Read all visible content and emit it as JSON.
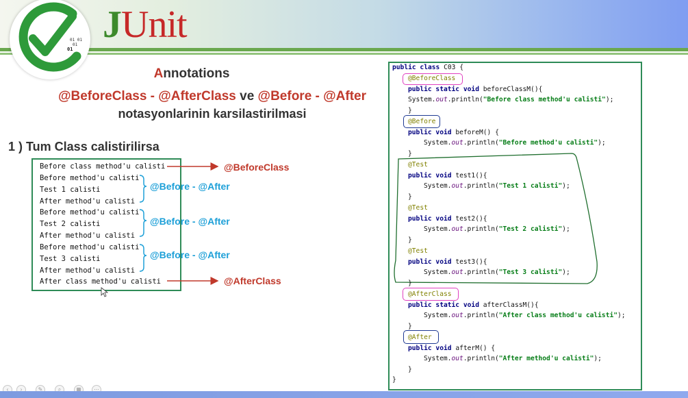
{
  "header": {
    "logo_text": "JUnit",
    "logo_j": "J",
    "logo_rest": "Unit",
    "logo_bits": "01 01 01"
  },
  "title": {
    "first": "A",
    "rest": "nnotations"
  },
  "subtitle": {
    "part1": "@BeforeClass - @AfterClass",
    "part2": " ve ",
    "part3": "@Before - @After",
    "line2": "notasyonlarinin karsilastirilmasi"
  },
  "section_heading": "1 ) Tum Class calistirilirsa",
  "console_output": [
    "Before class method'u calisti",
    "Before method'u calisti",
    "Test 1 calisti",
    "After method'u calisti",
    "Before method'u calisti",
    "Test 2 calisti",
    "After method'u calisti",
    "Before method'u calisti",
    "Test 3 calisti",
    "After method'u calisti",
    "After class method'u calisti"
  ],
  "labels": {
    "before_class": "@BeforeClass",
    "before_after_1": "@Before - @After",
    "before_after_2": "@Before - @After",
    "before_after_3": "@Before - @After",
    "after_class": "@AfterClass"
  },
  "colors": {
    "red": "#c0392b",
    "blue": "#1ea0d8",
    "green_border": "#2e8b57",
    "pink": "#e040c0",
    "navy": "#1f3a93"
  },
  "code": {
    "l01": "public class C03 {",
    "ann_before_class": "@BeforeClass",
    "l02a": "public static void",
    "l02b": " beforeClassM(){",
    "sys": "System.",
    "out": "out",
    "println": ".println(",
    "str_before_class": "\"Before class method'u calisti\"",
    "end": ");",
    "close": "}",
    "ann_before": "@Before",
    "l_beforeM_a": "public void",
    "l_beforeM_b": " beforeM() {",
    "str_before": "\"Before method'u calisti\"",
    "ann_test": "@Test",
    "test1_a": "public void",
    "test1_b": " test1(){",
    "str_test1": "\"Test 1 calisti\"",
    "test2_b": " test2(){",
    "str_test2": "\"Test 2 calisti\"",
    "test3_b": " test3(){",
    "str_test3": "\"Test 3 calisti\"",
    "ann_after_class": "@AfterClass",
    "ac_a": "public static void",
    "ac_b": " afterClassM(){",
    "str_after_class": "\"After class method'u calisti\"",
    "ann_after": "@After",
    "am_a": "public void",
    "am_b": " afterM() {",
    "str_after": "\"After method'u calisti\""
  }
}
